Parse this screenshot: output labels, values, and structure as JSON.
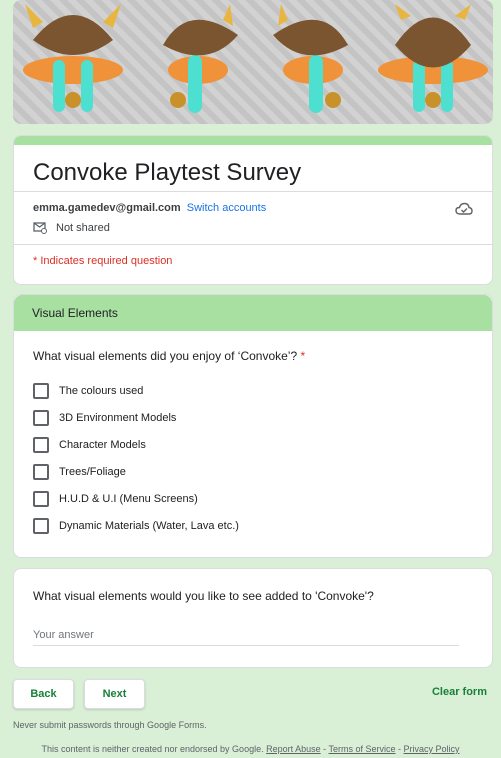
{
  "form": {
    "title": "Convoke Playtest Survey",
    "account_email": "emma.gamedev@gmail.com",
    "switch_accounts": "Switch accounts",
    "not_shared": "Not shared",
    "required_note": "* Indicates required question"
  },
  "section": {
    "header": "Visual Elements",
    "question": "What visual elements did you enjoy of ‘Convoke’?",
    "required_mark": "*",
    "options": [
      "The colours used",
      "3D Environment Models",
      "Character Models",
      "Trees/Foliage",
      "H.U.D & U.I (Menu Screens)",
      "Dynamic Materials (Water, Lava etc.)"
    ]
  },
  "question2": {
    "text": "What visual elements would you like to see added to 'Convoke'?",
    "placeholder": "Your answer"
  },
  "nav": {
    "back": "Back",
    "next": "Next",
    "clear": "Clear form"
  },
  "footer": {
    "never_submit": "Never submit passwords through Google Forms.",
    "disclaimer": "This content is neither created nor endorsed by Google.",
    "report_abuse": "Report Abuse",
    "sep1": " - ",
    "terms": "Terms of Service",
    "sep2": " - ",
    "privacy": "Privacy Policy"
  },
  "colors": {
    "theme": "#a8e0a2",
    "background": "#d9efd6",
    "accent": "#188038",
    "required": "#d93025"
  }
}
